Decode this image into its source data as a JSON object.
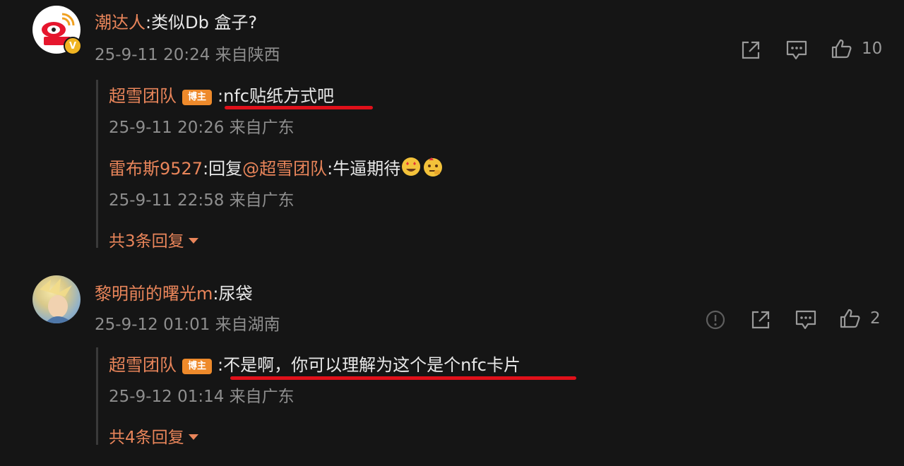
{
  "comments": [
    {
      "user": "潮达人",
      "text": ":类似Db 盒子?",
      "meta": "25-9-11 20:24 来自陕西",
      "avatar_badge": "V",
      "like_count": "10",
      "replies": [
        {
          "user": "超雪团队",
          "badge": "博主",
          "text": ":nfc贴纸方式吧",
          "meta": "25-9-11 20:26 来自广东"
        },
        {
          "user": "雷布斯9527",
          "text": ":回复",
          "mention": "@超雪团队",
          "text2": ":牛逼期待",
          "meta": "25-9-11 22:58 来自广东"
        }
      ],
      "more_replies": "共3条回复"
    },
    {
      "user": "黎明前的曙光m",
      "text": ":尿袋",
      "meta": "25-9-12 01:01 来自湖南",
      "like_count": "2",
      "replies": [
        {
          "user": "超雪团队",
          "badge": "博主",
          "text": ":不是啊，你可以理解为这个是个nfc卡片",
          "meta": "25-9-12 01:14 来自广东"
        }
      ],
      "more_replies": "共4条回复"
    }
  ],
  "colors": {
    "background": "#151515",
    "username": "#e9855a",
    "meta": "#8e8e8e",
    "underline": "#e0101a",
    "badge": "#ee8a2b"
  },
  "icons": [
    "share-icon",
    "comment-icon",
    "like-icon",
    "report-icon",
    "chevron-down-icon"
  ]
}
